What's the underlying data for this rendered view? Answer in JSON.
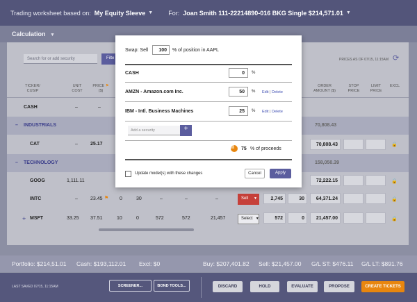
{
  "topbar": {
    "worksheet_label": "Trading worksheet based on:",
    "worksheet_value": "My Equity Sleeve",
    "for_label": "For:",
    "for_value": "Joan Smith 111-22214890-016 BKG Single $214,571.01"
  },
  "calc": {
    "label": "Calculation"
  },
  "toolbar": {
    "search_placeholder": "Search for or add security",
    "filter_label": "Filte",
    "prices_as_of": "PRICES AS OF 07/15, 11:15AM"
  },
  "columns": {
    "ticker": "TICKER/",
    "cusip": "CUSIP",
    "unit": "UNIT",
    "cost": "COST",
    "price": "PRICE",
    "price_unit": "($)",
    "order": "ORDER",
    "amount": "AMOUNT ($)",
    "stop": "STOP",
    "stop2": "PRICE",
    "limit": "LIMIT",
    "limit2": "PRICE",
    "excl": "EXCL"
  },
  "rows": {
    "cash": {
      "ticker": "CASH",
      "unit_cost": "–",
      "price": "–"
    },
    "industrials": {
      "label": "INDUSTRIALS",
      "amount": "70,808.43"
    },
    "cat": {
      "ticker": "CAT",
      "unit_cost": "–",
      "price": "25.17",
      "amount": "70,808.43"
    },
    "technology": {
      "label": "TECHNOLOGY",
      "amount": "158,050.39"
    },
    "goog": {
      "ticker": "GOOG",
      "unit_cost": "1,111.11",
      "amount": "72,222.15"
    },
    "intc": {
      "ticker": "INTC",
      "unit_cost": "–",
      "price": "23.45",
      "c3": "0",
      "c4": "30",
      "c5": "–",
      "c6": "–",
      "c7": "–",
      "action": "Sell",
      "qty": "2,745",
      "qty2": "30",
      "amount": "64,371.24"
    },
    "msft": {
      "ticker": "MSFT",
      "plus": "+",
      "unit_cost": "33.25",
      "price": "37.51",
      "c3": "10",
      "c4": "0",
      "c5": "572",
      "c6": "572",
      "c7": "21,457",
      "action": "Select",
      "qty": "572",
      "qty2": "0",
      "amount": "21,457.00"
    }
  },
  "statusbar": {
    "portfolio": "Portfolio: $214,51.01",
    "cash": "Cash: $193,112.01",
    "excl": "Excl: $0",
    "buy": "Buy: $207,401.82",
    "sell": "Sell: $21,457.00",
    "gl_st": "G/L ST: $476.11",
    "gl_lt": "G/L LT: $891.76"
  },
  "footer": {
    "last_saved": "LAST SAVED 07/15, 11:15AM",
    "screener": "SCREENER...",
    "bond_tools": "BOND TOOLS...",
    "discard": "DISCARD",
    "hold": "HOLD",
    "evaluate": "EVALUATE",
    "propose": "PROPOSE",
    "create": "CREATE TICKETS"
  },
  "modal": {
    "swap_label": "Swap: Sell",
    "swap_value": "100",
    "swap_suffix": "% of position in AAPL",
    "items": [
      {
        "name": "CASH",
        "pct": "0",
        "edit": "",
        "delete": ""
      },
      {
        "name": "AMZN - Amazon.com Inc.",
        "pct": "50",
        "edit": "Edit",
        "delete": "Delete"
      },
      {
        "name": "IBM - Intl. Business Machines",
        "pct": "25",
        "edit": "Edit",
        "delete": "Delete"
      }
    ],
    "pct_sign": "%",
    "separator": "|",
    "add_placeholder": "Add a security",
    "add_btn": "+",
    "proceeds_value": "75",
    "proceeds_label": "% of proceeds",
    "checkbox_label": "Update model(s) with these changes",
    "cancel": "Cancel",
    "apply": "Apply"
  },
  "colors": {
    "accent": "#5b5d9e",
    "sell": "#c6403a",
    "primary_action": "#e8860f"
  }
}
